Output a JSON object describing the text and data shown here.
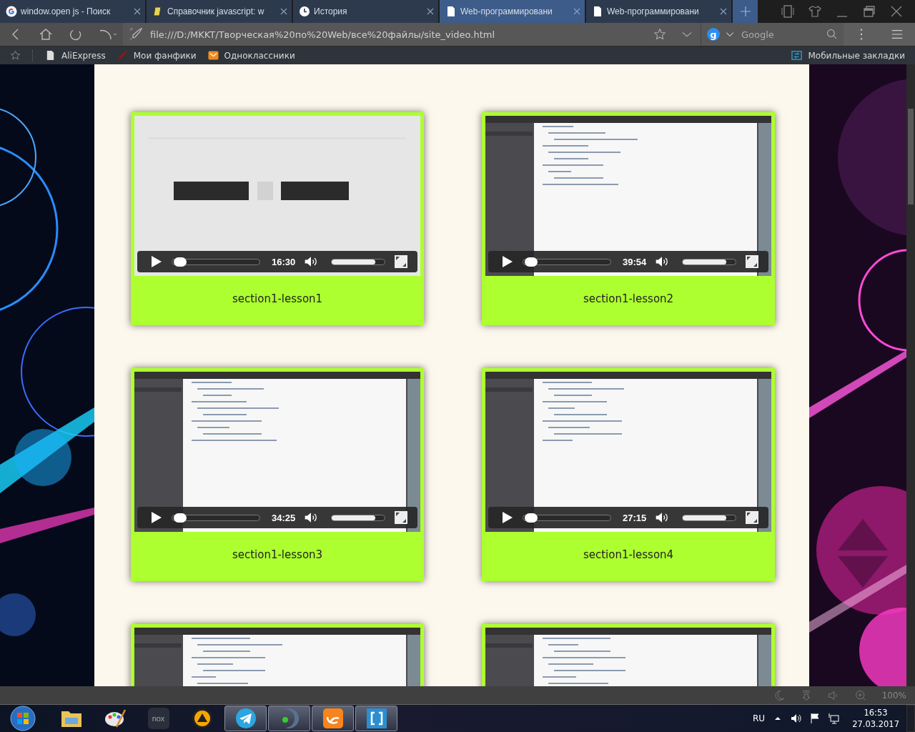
{
  "tabs": [
    {
      "title": "window.open js - Поиск",
      "kind": "google",
      "selected": false
    },
    {
      "title": "Справочник javascript: w",
      "kind": "script",
      "selected": false
    },
    {
      "title": "История",
      "kind": "clock",
      "selected": false
    },
    {
      "title": "Web-программировани",
      "kind": "page",
      "selected": true
    },
    {
      "title": "Web-программировани",
      "kind": "page",
      "selected": false
    }
  ],
  "address_bar": {
    "url": "file:///D:/MKKT/Творческая%20по%20Web/все%20файлы/site_video.html"
  },
  "search": {
    "engine_badge": "g",
    "placeholder": "Google"
  },
  "bookmarks": [
    {
      "label": "AliExpress",
      "kind": "page"
    },
    {
      "label": "Мои фанфики",
      "kind": "feather"
    },
    {
      "label": "Одноклассники",
      "kind": "mail"
    }
  ],
  "mobile_bookmarks": "Мобильные закладки",
  "page": {
    "videos": [
      {
        "title": "section1-lesson1",
        "time": "16:30",
        "progress": {
          "level": 0.03
        },
        "volume": {
          "level": 0.82
        },
        "kind": "title-slide"
      },
      {
        "title": "section1-lesson2",
        "time": "39:54",
        "progress": {
          "level": 0.03
        },
        "volume": {
          "level": 0.82
        },
        "kind": "editor"
      },
      {
        "title": "section1-lesson3",
        "time": "34:25",
        "progress": {
          "level": 0.03
        },
        "volume": {
          "level": 0.82
        },
        "kind": "editor"
      },
      {
        "title": "section1-lesson4",
        "time": "27:15",
        "progress": {
          "level": 0.03
        },
        "volume": {
          "level": 0.82
        },
        "kind": "editor"
      },
      {
        "kind": "editor"
      },
      {
        "kind": "editor"
      }
    ]
  },
  "status_bar": {
    "zoom": "100%"
  },
  "taskbar": {
    "apps": [
      {
        "kind": "folder",
        "running": false
      },
      {
        "kind": "palette",
        "running": false
      },
      {
        "kind": "nox",
        "label": "nox",
        "running": false
      },
      {
        "kind": "aimp",
        "running": false
      },
      {
        "kind": "telegram",
        "running": true
      },
      {
        "kind": "player",
        "running": true
      },
      {
        "kind": "uc",
        "running": true
      },
      {
        "kind": "brackets",
        "running": true
      }
    ],
    "language": "RU",
    "time": "16:53",
    "date": "27.03.2017"
  }
}
